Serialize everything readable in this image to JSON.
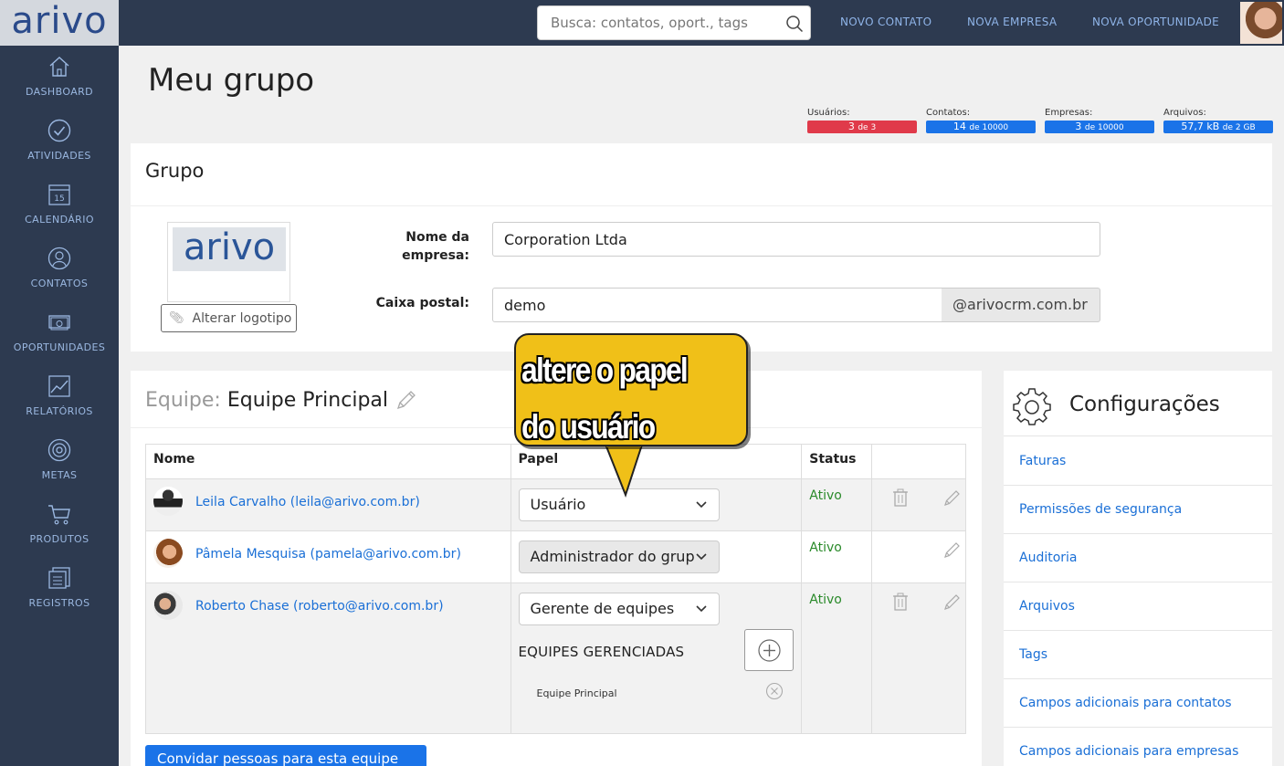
{
  "topbar": {
    "logo": "arivo",
    "search_placeholder": "Busca: contatos, oport., tags",
    "links": [
      "NOVO CONTATO",
      "NOVA EMPRESA",
      "NOVA OPORTUNIDADE"
    ]
  },
  "sidebar": {
    "items": [
      {
        "label": "DASHBOARD",
        "icon": "home-icon"
      },
      {
        "label": "ATIVIDADES",
        "icon": "check-circle-icon"
      },
      {
        "label": "CALENDÁRIO",
        "icon": "calendar-icon",
        "day": "15"
      },
      {
        "label": "CONTATOS",
        "icon": "contact-icon"
      },
      {
        "label": "OPORTUNIDADES",
        "icon": "money-icon"
      },
      {
        "label": "RELATÓRIOS",
        "icon": "chart-icon"
      },
      {
        "label": "METAS",
        "icon": "target-icon"
      },
      {
        "label": "PRODUTOS",
        "icon": "cart-icon"
      },
      {
        "label": "REGISTROS",
        "icon": "records-icon"
      }
    ]
  },
  "page": {
    "title": "Meu grupo"
  },
  "stats": [
    {
      "label": "Usuários:",
      "value": "3",
      "suffix": "de 3",
      "color": "#e03a4a"
    },
    {
      "label": "Contatos:",
      "value": "14",
      "suffix": "de 10000",
      "color": "#1a73e8"
    },
    {
      "label": "Empresas:",
      "value": "3",
      "suffix": "de 10000",
      "color": "#1a73e8"
    },
    {
      "label": "Arquivos:",
      "value": "57,7 kB",
      "suffix": "de 2 GB",
      "color": "#1a73e8"
    }
  ],
  "grupo": {
    "title": "Grupo",
    "logo_text": "arivo",
    "change_logo": "Alterar logotipo",
    "company_label_1": "Nome da",
    "company_label_2": "empresa:",
    "company_value": "Corporation Ltda",
    "mailbox_label": "Caixa postal:",
    "mailbox_value": "demo",
    "mailbox_domain": "@arivocrm.com.br"
  },
  "team": {
    "prefix": "Equipe:",
    "name": "Equipe Principal",
    "columns": [
      "Nome",
      "Papel",
      "Status",
      ""
    ],
    "members": [
      {
        "name": "Leila Carvalho (leila@arivo.com.br)",
        "role": "Usuário",
        "status": "Ativo"
      },
      {
        "name": "Pâmela Mesquisa (pamela@arivo.com.br)",
        "role": "Administrador do grupo",
        "status": "Ativo"
      },
      {
        "name": "Roberto Chase (roberto@arivo.com.br)",
        "role": "Gerente de equipes",
        "status": "Ativo"
      }
    ],
    "managed_title": "EQUIPES GERENCIADAS",
    "managed_item": "Equipe Principal",
    "invite": "Convidar pessoas para esta equipe"
  },
  "settings": {
    "title": "Configurações",
    "links": [
      "Faturas",
      "Permissões de segurança",
      "Auditoria",
      "Arquivos",
      "Tags",
      "Campos adicionais para contatos",
      "Campos adicionais para empresas"
    ]
  },
  "callout": {
    "line1": "altere o papel",
    "line2": "do usuário"
  }
}
